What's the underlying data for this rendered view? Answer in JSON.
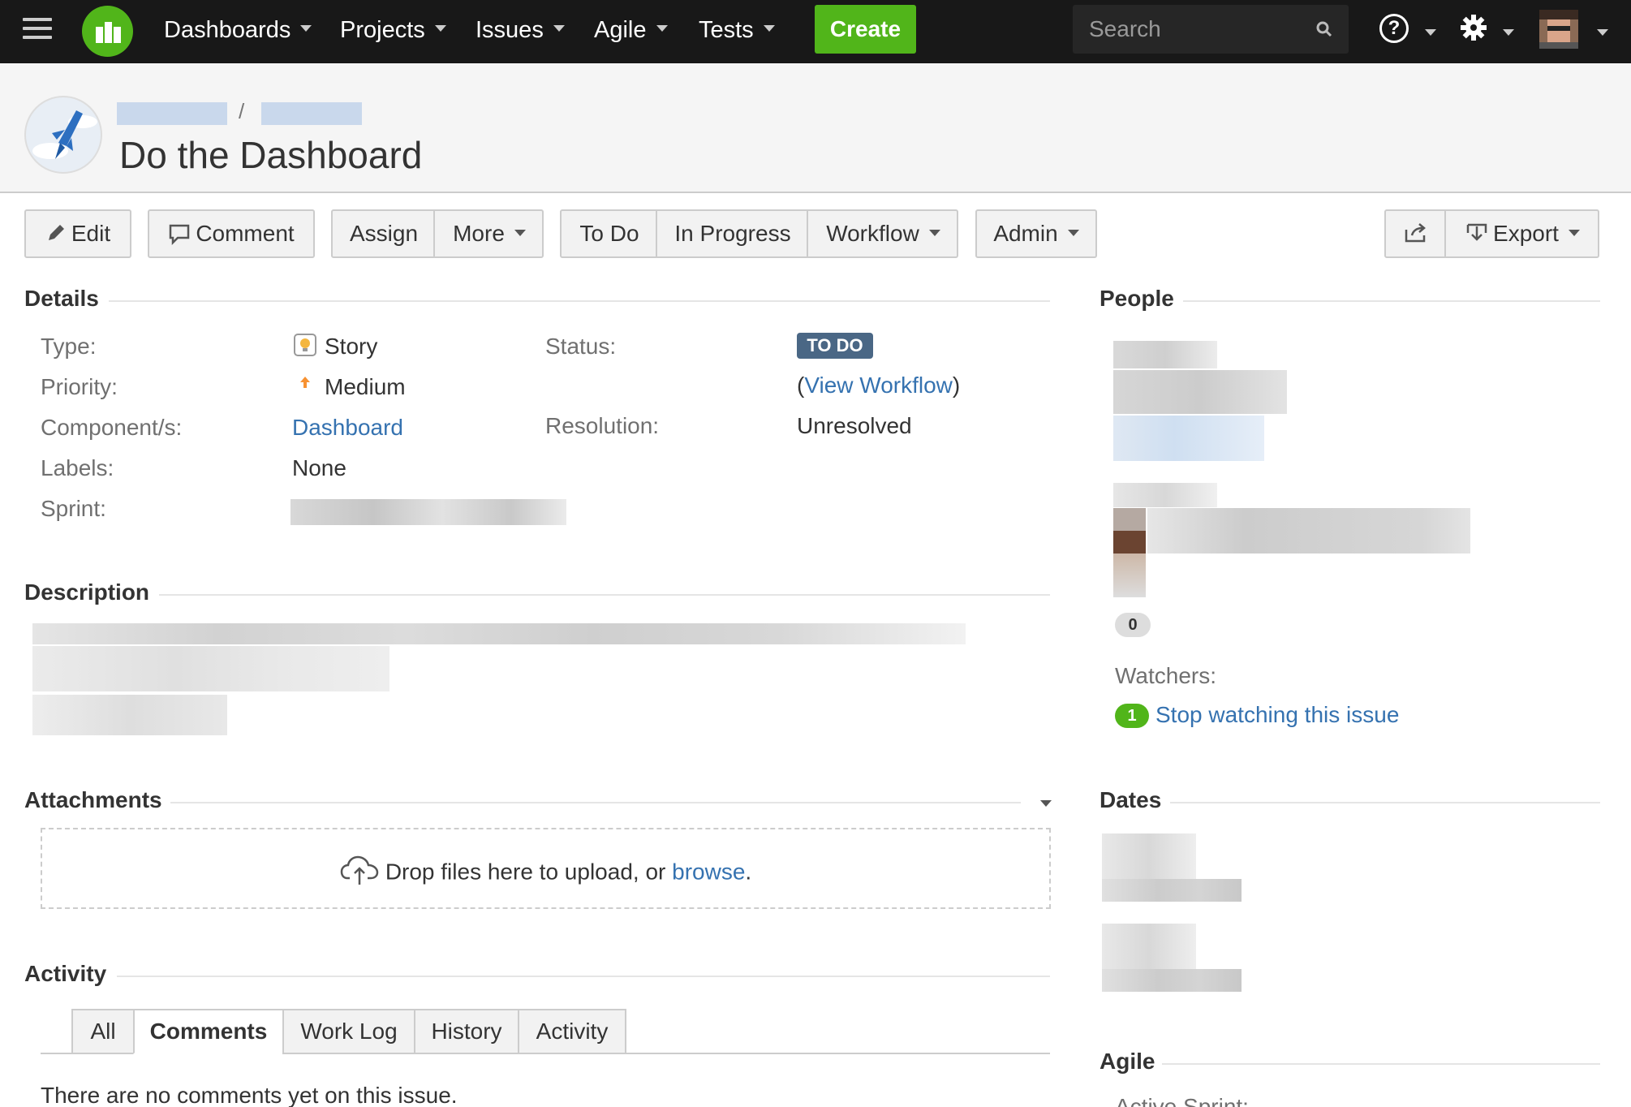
{
  "topnav": {
    "items": [
      {
        "label": "Dashboards"
      },
      {
        "label": "Projects"
      },
      {
        "label": "Issues"
      },
      {
        "label": "Agile"
      },
      {
        "label": "Tests"
      }
    ],
    "create_label": "Create",
    "search_placeholder": "Search",
    "help_glyph": "?"
  },
  "header": {
    "breadcrumb_sep": "/",
    "title": "Do the Dashboard"
  },
  "toolbar": {
    "edit": "Edit",
    "comment": "Comment",
    "assign": "Assign",
    "more": "More",
    "todo": "To Do",
    "in_progress": "In Progress",
    "workflow": "Workflow",
    "admin": "Admin",
    "export": "Export"
  },
  "details": {
    "title": "Details",
    "type_label": "Type:",
    "type_value": "Story",
    "priority_label": "Priority:",
    "priority_value": "Medium",
    "components_label": "Component/s:",
    "components_value": "Dashboard",
    "labels_label": "Labels:",
    "labels_value": "None",
    "sprint_label": "Sprint:",
    "status_label": "Status:",
    "status_value": "TO DO",
    "workflow_open": "(",
    "workflow_link": "View Workflow",
    "workflow_close": ")",
    "resolution_label": "Resolution:",
    "resolution_value": "Unresolved"
  },
  "description": {
    "title": "Description"
  },
  "attachments": {
    "title": "Attachments",
    "drop_text": "Drop files here to upload, or ",
    "browse_link": "browse",
    "drop_end": "."
  },
  "activity": {
    "title": "Activity",
    "tabs": [
      {
        "label": "All"
      },
      {
        "label": "Comments"
      },
      {
        "label": "Work Log"
      },
      {
        "label": "History"
      },
      {
        "label": "Activity"
      }
    ],
    "empty_text": "There are no comments yet on this issue."
  },
  "people": {
    "title": "People",
    "votes_count": "0",
    "watchers_label": "Watchers:",
    "watchers_count": "1",
    "stop_watching": "Stop watching this issue"
  },
  "dates": {
    "title": "Dates"
  },
  "agile": {
    "title": "Agile",
    "active_sprint_label": "Active Sprint:"
  },
  "colors": {
    "nav_bg": "#181818",
    "brand_green": "#51b51a",
    "link_blue": "#3572b0",
    "status_todo": "#4a6785"
  }
}
